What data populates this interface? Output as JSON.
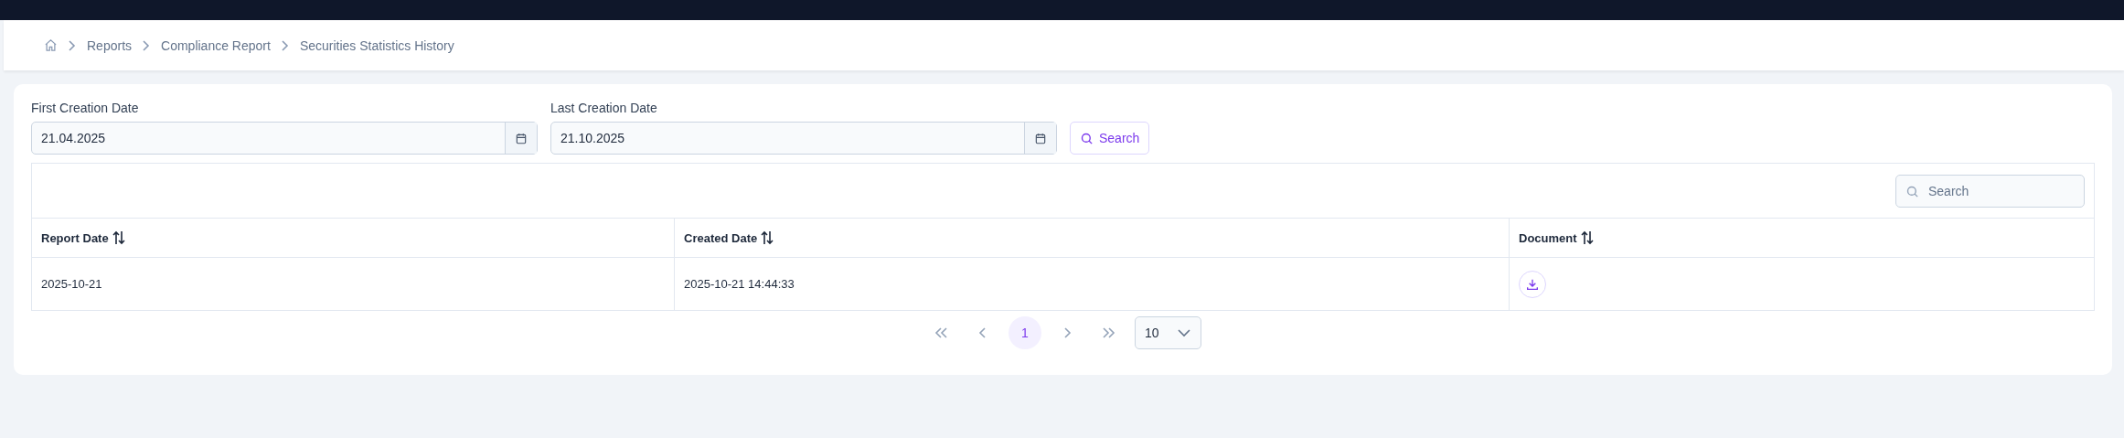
{
  "breadcrumb": [
    {
      "label": "Reports"
    },
    {
      "label": "Compliance Report"
    },
    {
      "label": "Securities Statistics History"
    }
  ],
  "filters": [
    {
      "label": "First Creation Date",
      "value": "21.04.2025"
    },
    {
      "label": "Last Creation Date",
      "value": "21.10.2025"
    }
  ],
  "search_button": {
    "label": "Search"
  },
  "table": {
    "search": {
      "placeholder": "Search"
    },
    "columns": [
      {
        "label": "Report Date"
      },
      {
        "label": "Created Date"
      },
      {
        "label": "Document"
      }
    ],
    "rows": [
      {
        "report_date": "2025-10-21",
        "created_date": "2025-10-21 14:44:33"
      }
    ]
  },
  "pagination": {
    "pages": [
      {
        "label": "1",
        "selected": true
      }
    ],
    "page_size": "10"
  }
}
